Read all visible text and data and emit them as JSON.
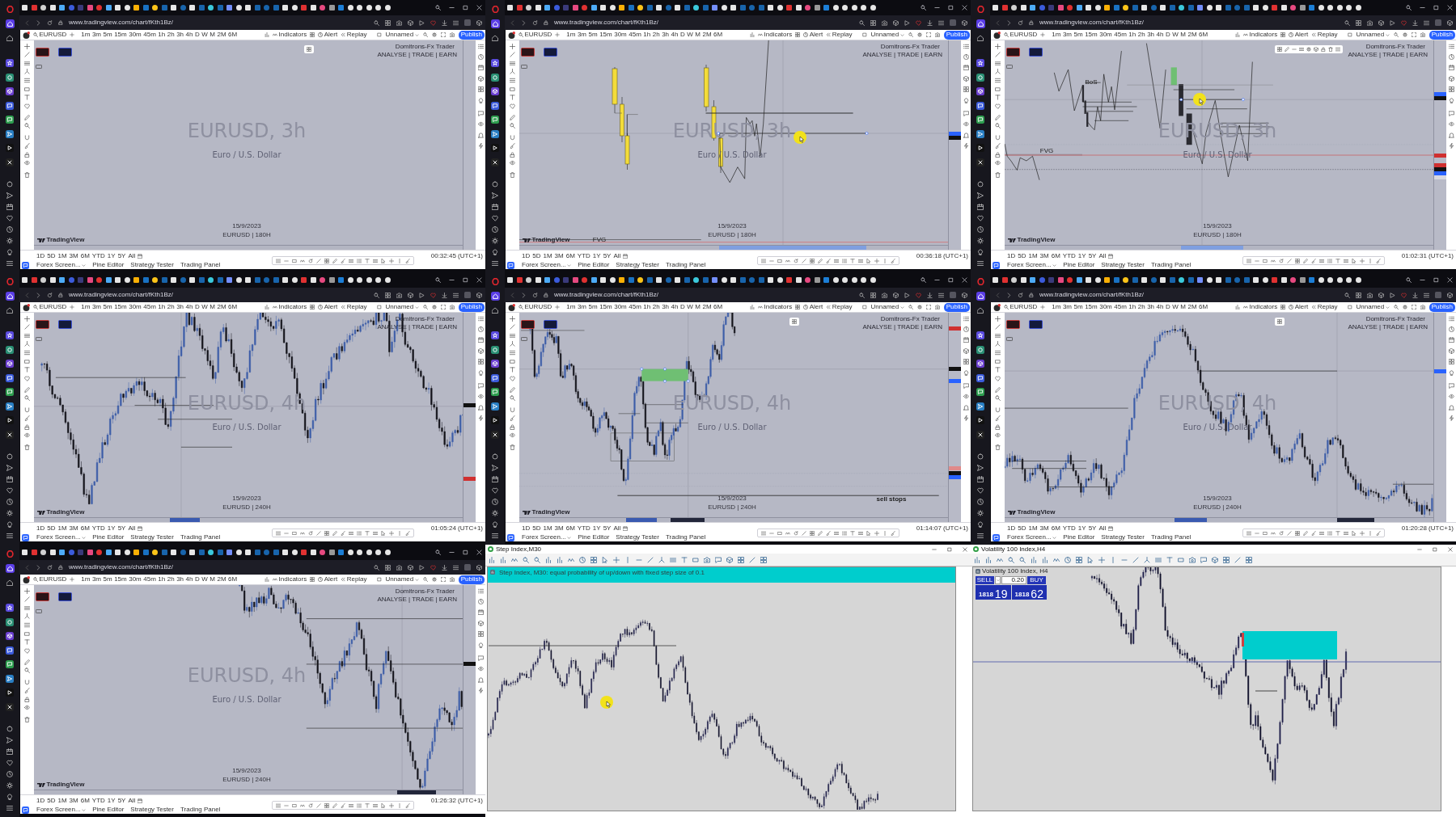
{
  "panels": [
    {
      "kind": "browser",
      "url": "www.tradingview.com/chart/fKth1Bz/",
      "symbol": "EURUSD",
      "intervals": [
        "1m",
        "3m",
        "5m",
        "15m",
        "30m",
        "45m",
        "1h",
        "2h",
        "3h",
        "4h",
        "D",
        "W",
        "M",
        "2M",
        "6M"
      ],
      "tools": [
        "Indicators",
        "Alert",
        "Replay"
      ],
      "layout": "Unnamed",
      "publish": "Publish",
      "floating_toolbar": true,
      "toolbar_expanded": false,
      "brand": "Domitrons-Fx Trader",
      "tagline": "ANALYSE | TRADE | EARN",
      "watermark": "EURUSD, 3h",
      "description": "Euro / U.S. Dollar",
      "date": "15/9/2023",
      "caption": "EURUSD | 180H",
      "logo": "TradingView",
      "ranges": [
        "1D",
        "5D",
        "1M",
        "3M",
        "6M",
        "YTD",
        "1Y",
        "5Y",
        "All"
      ],
      "clock": "00:32:45 (UTC+1)",
      "bottom_tabs": [
        "Forex Screen...",
        "Pine Editor",
        "Strategy Tester",
        "Trading Panel"
      ]
    },
    {
      "kind": "browser",
      "url": "www.tradingview.com/chart/fKth1Bz/",
      "symbol": "EURUSD",
      "intervals": [
        "1m",
        "3m",
        "5m",
        "15m",
        "30m",
        "45m",
        "1h",
        "2h",
        "3h",
        "4h",
        "D",
        "W",
        "M",
        "2M",
        "6M"
      ],
      "tools": [
        "Indicators",
        "Alert",
        "Replay"
      ],
      "layout": "Unnamed",
      "publish": "Publish",
      "floating_toolbar": false,
      "brand": "Domitrons-Fx Trader",
      "tagline": "ANALYSE | TRADE | EARN",
      "watermark": "EURUSD, 3h",
      "description": "Euro / U.S. Dollar",
      "date": "15/9/2023",
      "caption": "EURUSD | 180H",
      "logo": "TradingView",
      "ranges": [
        "1D",
        "5D",
        "1M",
        "3M",
        "6M",
        "YTD",
        "1Y",
        "5Y",
        "All"
      ],
      "clock": "00:36:18 (UTC+1)",
      "bottom_tabs": [
        "Forex Screen...",
        "Pine Editor",
        "Strategy Tester",
        "Trading Panel"
      ],
      "notes": [
        {
          "text": "FVG"
        }
      ]
    },
    {
      "kind": "browser",
      "url": "www.tradingview.com/chart/fKth1Bz/",
      "symbol": "EURUSD",
      "intervals": [
        "1m",
        "3m",
        "5m",
        "15m",
        "30m",
        "45m",
        "1h",
        "2h",
        "3h",
        "4h",
        "D",
        "W",
        "M",
        "2M",
        "6M"
      ],
      "tools": [
        "Indicators",
        "Alert",
        "Replay"
      ],
      "layout": "Unnamed",
      "publish": "Publish",
      "floating_toolbar": true,
      "toolbar_expanded": true,
      "brand": "Domitrons-Fx Trader",
      "tagline": "ANALYSE | TRADE | EARN",
      "watermark": "EURUSD, 3h",
      "description": "Euro / U.S. Dollar",
      "date": "15/9/2023",
      "caption": "EURUSD | 180H",
      "logo": "TradingView",
      "ranges": [
        "1D",
        "5D",
        "1M",
        "3M",
        "6M",
        "YTD",
        "1Y",
        "5Y",
        "All"
      ],
      "clock": "01:02:31 (UTC+1)",
      "bottom_tabs": [
        "Forex Screen...",
        "Pine Editor",
        "Strategy Tester",
        "Trading Panel"
      ],
      "notes": [
        {
          "text": "BoS"
        },
        {
          "text": "FVG"
        }
      ]
    },
    {
      "kind": "browser",
      "url": "www.tradingview.com/chart/fKth1Bz/",
      "symbol": "EURUSD",
      "intervals": [
        "1m",
        "3m",
        "5m",
        "15m",
        "30m",
        "45m",
        "1h",
        "2h",
        "3h",
        "4h",
        "D",
        "W",
        "M",
        "2M",
        "6M"
      ],
      "tools": [
        "Indicators",
        "Alert",
        "Replay"
      ],
      "layout": "Unnamed",
      "publish": "Publish",
      "floating_toolbar": false,
      "brand": "Domitrons-Fx Trader",
      "tagline": "ANALYSE | TRADE | EARN",
      "watermark": "EURUSD, 4h",
      "description": "Euro / U.S. Dollar",
      "date": "15/9/2023",
      "caption": "EURUSD | 240H",
      "logo": "TradingView",
      "ranges": [
        "1D",
        "5D",
        "1M",
        "3M",
        "6M",
        "YTD",
        "1Y",
        "5Y",
        "All"
      ],
      "clock": "01:05:24 (UTC+1)",
      "bottom_tabs": [
        "Forex Screen...",
        "Pine Editor",
        "Strategy Tester",
        "Trading Panel"
      ]
    },
    {
      "kind": "browser",
      "url": "www.tradingview.com/chart/fKth1Bz/",
      "symbol": "EURUSD",
      "intervals": [
        "1m",
        "3m",
        "5m",
        "15m",
        "30m",
        "45m",
        "1h",
        "2h",
        "3h",
        "4h",
        "D",
        "W",
        "M",
        "2M",
        "6M"
      ],
      "tools": [
        "Indicators",
        "Alert",
        "Replay"
      ],
      "layout": "Unnamed",
      "publish": "Publish",
      "floating_toolbar": true,
      "toolbar_expanded": false,
      "brand": "Domitrons-Fx Trader",
      "tagline": "ANALYSE | TRADE | EARN",
      "watermark": "EURUSD, 4h",
      "description": "Euro / U.S. Dollar",
      "date": "15/9/2023",
      "caption": "EURUSD | 240H",
      "logo": "TradingView",
      "ranges": [
        "1D",
        "5D",
        "1M",
        "3M",
        "6M",
        "YTD",
        "1Y",
        "5Y",
        "All"
      ],
      "clock": "01:14:07 (UTC+1)",
      "bottom_tabs": [
        "Forex Screen...",
        "Pine Editor",
        "Strategy Tester",
        "Trading Panel"
      ],
      "notes": [
        {
          "text": "sell stops"
        }
      ]
    },
    {
      "kind": "browser",
      "url": "www.tradingview.com/chart/fKth1Bz/",
      "symbol": "EURUSD",
      "intervals": [
        "1m",
        "3m",
        "5m",
        "15m",
        "30m",
        "45m",
        "1h",
        "2h",
        "3h",
        "4h",
        "D",
        "W",
        "M",
        "2M",
        "6M"
      ],
      "tools": [
        "Indicators",
        "Alert",
        "Replay"
      ],
      "layout": "Unnamed",
      "publish": "Publish",
      "floating_toolbar": true,
      "toolbar_expanded": false,
      "brand": "Domitrons-Fx Trader",
      "tagline": "ANALYSE | TRADE | EARN",
      "watermark": "EURUSD, 4h",
      "description": "Euro / U.S. Dollar",
      "date": "15/9/2023",
      "caption": "EURUSD | 240H",
      "logo": "TradingView",
      "ranges": [
        "1D",
        "5D",
        "1M",
        "3M",
        "6M",
        "YTD",
        "1Y",
        "5Y",
        "All"
      ],
      "clock": "01:20:28 (UTC+1)",
      "bottom_tabs": [
        "Forex Screen...",
        "Pine Editor",
        "Strategy Tester",
        "Trading Panel"
      ]
    },
    {
      "kind": "browser",
      "url": "www.tradingview.com/chart/fKth1Bz/",
      "symbol": "EURUSD",
      "intervals": [
        "1m",
        "3m",
        "5m",
        "15m",
        "30m",
        "45m",
        "1h",
        "2h",
        "3h",
        "4h",
        "D",
        "W",
        "M",
        "2M",
        "6M"
      ],
      "tools": [
        "Indicators",
        "Alert",
        "Replay"
      ],
      "layout": "Unnamed",
      "publish": "Publish",
      "floating_toolbar": false,
      "brand": "Domitrons-Fx Trader",
      "tagline": "ANALYSE | TRADE | EARN",
      "watermark": "EURUSD, 4h",
      "description": "Euro / U.S. Dollar",
      "date": "15/9/2023",
      "caption": "EURUSD | 240H",
      "logo": "TradingView",
      "ranges": [
        "1D",
        "5D",
        "1M",
        "3M",
        "6M",
        "YTD",
        "1Y",
        "5Y",
        "All"
      ],
      "clock": "01:26:32 (UTC+1)",
      "bottom_tabs": [
        "Forex Screen...",
        "Pine Editor",
        "Strategy Tester",
        "Trading Panel"
      ]
    },
    {
      "kind": "terminal",
      "title": "Step Index,M30",
      "banner": "Step Index, M30: equal probability of up/down with fixed step size of 0.1"
    },
    {
      "kind": "terminal",
      "title": "Volatility 100 Index,H4",
      "chart_label": "Volatility 100 Index, H4",
      "trade": {
        "sell": "SELL",
        "volume": "0.20",
        "buy": "BUY",
        "sell_price": "1818",
        "sell_pips": "19",
        "buy_price": "1818",
        "buy_pips": "62"
      }
    }
  ]
}
